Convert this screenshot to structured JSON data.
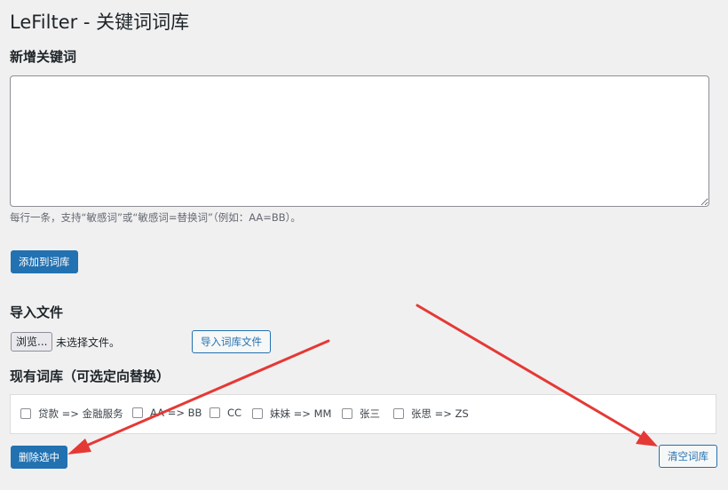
{
  "page": {
    "title": "LeFilter - 关键词词库"
  },
  "add_section": {
    "heading": "新增关键词",
    "textarea_value": "",
    "description": "每行一条，支持“敏感词”或“敏感词=替换词”（例如：AA=BB）。",
    "add_button": "添加到词库"
  },
  "import_section": {
    "heading": "导入文件",
    "browse_button": "浏览...",
    "no_file_text": "未选择文件。",
    "import_button": "导入词库文件"
  },
  "library_section": {
    "heading": "现有词库（可选定向替换）",
    "items": [
      {
        "label": "贷款 => 金融服务",
        "checked": false
      },
      {
        "label": "AA => BB",
        "checked": false
      },
      {
        "label": "CC",
        "checked": false
      },
      {
        "label": "妹妹 => MM",
        "checked": false
      },
      {
        "label": "张三",
        "checked": false
      },
      {
        "label": "张思 => ZS",
        "checked": false
      }
    ],
    "delete_button": "删除选中",
    "clear_button": "清空词库"
  },
  "colors": {
    "primary": "#2271b1",
    "background": "#f0f0f1",
    "annotation_arrow": "#e53935"
  }
}
